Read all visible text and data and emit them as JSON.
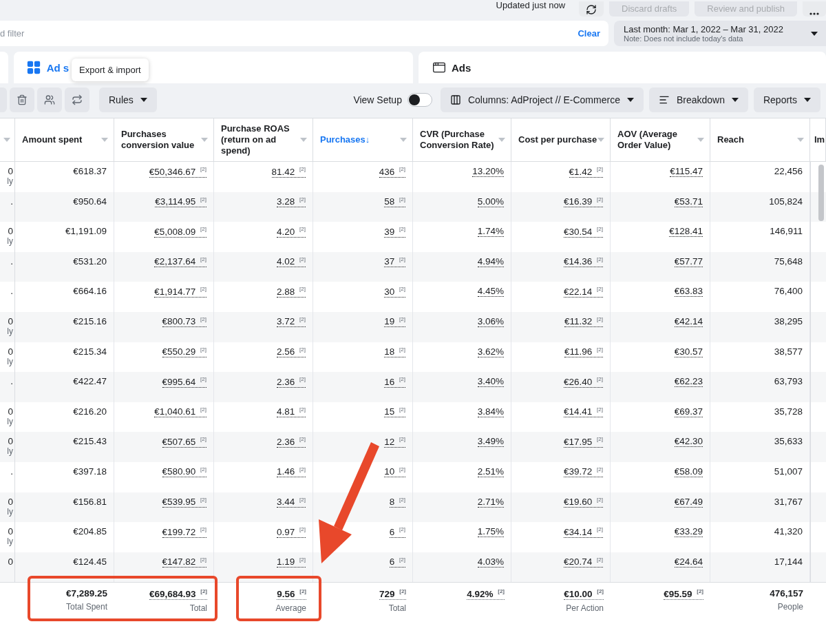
{
  "top_bar": {
    "status": "Updated just now",
    "buttons": [
      {
        "kind": "refresh"
      },
      {
        "kind": "text",
        "label": "Discard drafts",
        "disabled": true
      },
      {
        "kind": "text",
        "label": "Review and publish",
        "disabled": true
      },
      {
        "kind": "more"
      }
    ]
  },
  "filter": {
    "placeholder": "d filter",
    "clear": "Clear"
  },
  "date_range": {
    "label": "Last month: Mar 1, 2022 – Mar 31, 2022",
    "note": "Note: Does not include today's data"
  },
  "tabs": [
    {
      "label": "Ad s",
      "kind": "grid",
      "selected": true
    },
    {
      "label": "Ads",
      "kind": "window",
      "selected": false
    }
  ],
  "tooltip": "Export & import",
  "toolbar": {
    "left": [
      {
        "kind": "cut"
      },
      {
        "kind": "trash"
      },
      {
        "kind": "people"
      },
      {
        "kind": "export"
      },
      {
        "kind": "dropdown",
        "label": "Rules"
      }
    ],
    "view_setup": {
      "label": "View Setup",
      "on": false
    },
    "right": [
      {
        "kind": "columns",
        "label": "Columns: AdProject // E-Commerce"
      },
      {
        "kind": "breakdown",
        "label": "Breakdown"
      },
      {
        "kind": "plain",
        "label": "Reports"
      }
    ]
  },
  "table": {
    "columns": [
      {
        "label": "Amount spent",
        "sorted": false,
        "underlined": false
      },
      {
        "label": "Purchases conversion value",
        "sorted": false,
        "underlined": true
      },
      {
        "label": "Purchase ROAS (return on ad spend)",
        "sorted": false,
        "underlined": true
      },
      {
        "label": "Purchases",
        "sort_mark": "↓",
        "sorted": true,
        "underlined": true
      },
      {
        "label": "CVR (Purchase Conversion Rate)",
        "sorted": false,
        "underlined": true
      },
      {
        "label": "Cost per purchase",
        "sorted": false,
        "underlined": true
      },
      {
        "label": "AOV (Average Order Value)",
        "sorted": false,
        "underlined": true
      },
      {
        "label": "Reach",
        "sorted": false,
        "underlined": false
      },
      {
        "label": "Im",
        "sorted": false
      }
    ],
    "rows": [
      {
        "lead": "0",
        "lead_note": "ly",
        "cells": [
          "€618.37",
          "€50,346.67 $^{[2]}$",
          "81.42 $^{[2]}$",
          "436 $^{[2]}$",
          "13.20%",
          "€1.42 $^{[2]}$",
          "€115.47",
          "22,456"
        ]
      },
      {
        "lead": ".",
        "cells": [
          "€950.64",
          "€3,114.95 $^{[2]}$",
          "3.28 $^{[2]}$",
          "58 $^{[2]}$",
          "5.00%",
          "€16.39 $^{[2]}$",
          "€53.71",
          "105,824"
        ]
      },
      {
        "lead": "0",
        "lead_note": "ly",
        "cells": [
          "€1,191.09",
          "€5,008.09 $^{[2]}$",
          "4.20 $^{[2]}$",
          "39 $^{[2]}$",
          "1.74%",
          "€30.54 $^{[2]}$",
          "€128.41",
          "146,911"
        ]
      },
      {
        "lead": ".",
        "cells": [
          "€531.20",
          "€2,137.64 $^{[2]}$",
          "4.02 $^{[2]}$",
          "37 $^{[2]}$",
          "4.94%",
          "€14.36 $^{[2]}$",
          "€57.77",
          "75,648"
        ]
      },
      {
        "lead": ".",
        "cells": [
          "€664.16",
          "€1,914.77 $^{[2]}$",
          "2.88 $^{[2]}$",
          "30 $^{[2]}$",
          "4.45%",
          "€22.14 $^{[2]}$",
          "€63.83",
          "76,400"
        ]
      },
      {
        "lead": "0",
        "lead_note": "ly",
        "cells": [
          "€215.16",
          "€800.73 $^{[2]}$",
          "3.72 $^{[2]}$",
          "19 $^{[2]}$",
          "3.06%",
          "€11.32 $^{[2]}$",
          "€42.14",
          "38,295"
        ]
      },
      {
        "lead": "0",
        "lead_note": "ly",
        "cells": [
          "€215.34",
          "€550.29 $^{[2]}$",
          "2.56 $^{[2]}$",
          "18 $^{[2]}$",
          "3.62%",
          "€11.96 $^{[2]}$",
          "€30.57",
          "38,577"
        ]
      },
      {
        "lead": ".",
        "cells": [
          "€422.47",
          "€995.64 $^{[2]}$",
          "2.36 $^{[2]}$",
          "16 $^{[2]}$",
          "3.40%",
          "€26.40 $^{[2]}$",
          "€62.23",
          "63,793"
        ]
      },
      {
        "lead": "0",
        "lead_note": "ly",
        "cells": [
          "€216.20",
          "€1,040.61 $^{[2]}$",
          "4.81 $^{[2]}$",
          "15 $^{[2]}$",
          "3.84%",
          "€14.41 $^{[2]}$",
          "€69.37",
          "35,728"
        ]
      },
      {
        "lead": "0",
        "lead_note": "ly",
        "cells": [
          "€215.43",
          "€507.65 $^{[2]}$",
          "2.36 $^{[2]}$",
          "12 $^{[2]}$",
          "3.49%",
          "€17.95 $^{[2]}$",
          "€42.30",
          "35,633"
        ]
      },
      {
        "lead": ".",
        "cells": [
          "€397.18",
          "€580.90 $^{[2]}$",
          "1.46 $^{[2]}$",
          "10 $^{[2]}$",
          "2.51%",
          "€39.72 $^{[2]}$",
          "€58.09",
          "51,007"
        ]
      },
      {
        "lead": "0",
        "lead_note": "ly",
        "cells": [
          "€156.81",
          "€539.95 $^{[2]}$",
          "3.44 $^{[2]}$",
          "8 $^{[2]}$",
          "2.71%",
          "€19.60 $^{[2]}$",
          "€67.49",
          "31,767"
        ]
      },
      {
        "lead": "0",
        "lead_note": "ly",
        "cells": [
          "€204.85",
          "€199.72 $^{[2]}$",
          "0.97 $^{[2]}$",
          "6 $^{[2]}$",
          "1.75%",
          "€34.14 $^{[2]}$",
          "€33.29",
          "41,320"
        ]
      },
      {
        "lead": "0",
        "cells": [
          "€124.45",
          "€147.82 $^{[2]}$",
          "1.19 $^{[2]}$",
          "6 $^{[2]}$",
          "4.03%",
          "€20.74 $^{[2]}$",
          "€24.64",
          "17,144"
        ]
      }
    ],
    "total_groups": [
      {
        "framed": true,
        "arrow": false,
        "cells": [
          {
            "value": "€7,289.25",
            "caption": "Total Spent"
          },
          {
            "value": "€69,684.93 $^{[2]}$",
            "caption": "Total"
          }
        ]
      },
      {
        "framed": true,
        "arrow": true,
        "cells": [
          {
            "value": "9.56 $^{[2]}$",
            "caption": "Average"
          }
        ]
      },
      {
        "framed": false,
        "arrow": false,
        "cells": [
          {
            "value": "729 $^{[2]}$",
            "caption": "Total"
          }
        ]
      },
      {
        "framed": false,
        "arrow": false,
        "cells": [
          {
            "value": "4.92% $^{[2]}$"
          }
        ]
      },
      {
        "framed": false,
        "arrow": false,
        "cells": [
          {
            "value": "€10.00 $^{[2]}$",
            "caption": "Per Action"
          }
        ]
      },
      {
        "framed": false,
        "arrow": false,
        "cells": [
          {
            "value": "€95.59 $^{[2]}$"
          }
        ]
      },
      {
        "framed": false,
        "arrow": false,
        "cells": [
          {
            "value": "476,157",
            "caption": "People"
          }
        ]
      }
    ]
  }
}
